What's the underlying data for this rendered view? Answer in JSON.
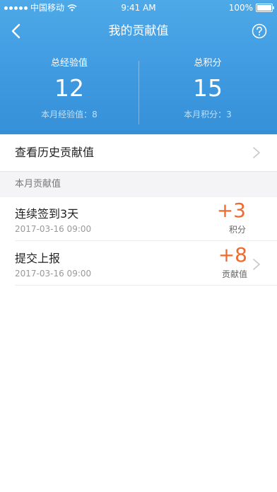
{
  "status_bar": {
    "carrier": "中国移动",
    "time": "9:41 AM",
    "battery": "100%"
  },
  "nav": {
    "title": "我的贡献值",
    "back_icon": "chevron-left-icon",
    "help_icon": "question-circle-icon"
  },
  "stats": {
    "experience": {
      "label": "总经验值",
      "value": "12",
      "sub": "本月经验值：8"
    },
    "points": {
      "label": "总积分",
      "value": "15",
      "sub": "本月积分：3"
    }
  },
  "history": {
    "label": "查看历史贡献值"
  },
  "section": {
    "label": "本月贡献值"
  },
  "records": [
    {
      "title": "连续签到3天",
      "time": "2017-03-16  09:00",
      "value": "+3",
      "unit": "积分"
    },
    {
      "title": "提交上报",
      "time": "2017-03-16  09:00",
      "value": "+8",
      "unit": "贡献值"
    }
  ],
  "colors": {
    "header": "#3f9ae0",
    "accent": "#ef6a2e"
  }
}
